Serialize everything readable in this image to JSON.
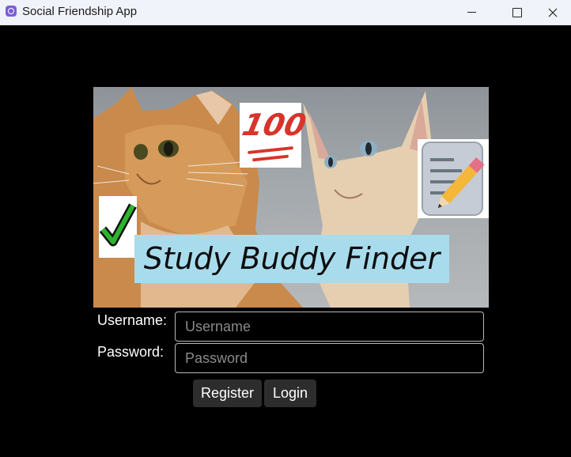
{
  "window": {
    "title": "Social Friendship App",
    "app_icon": "app-icon",
    "controls": [
      "minimize-icon",
      "maximize-icon",
      "close-icon"
    ]
  },
  "banner": {
    "title": "Study Buddy Finder",
    "stickers": [
      "hundred-points-emoji",
      "check-mark-emoji",
      "memo-pencil-emoji"
    ],
    "hundred_text": "100",
    "title_bg": "#a8dced"
  },
  "form": {
    "username_label": "Username:",
    "username_placeholder": "Username",
    "username_value": "",
    "password_label": "Password:",
    "password_placeholder": "Password",
    "password_value": "",
    "register_label": "Register",
    "login_label": "Login"
  },
  "colors": {
    "background": "#000000",
    "titlebar": "#f0f3f9",
    "button_bg": "#2d2d2d",
    "field_border": "#b9b9b9"
  }
}
